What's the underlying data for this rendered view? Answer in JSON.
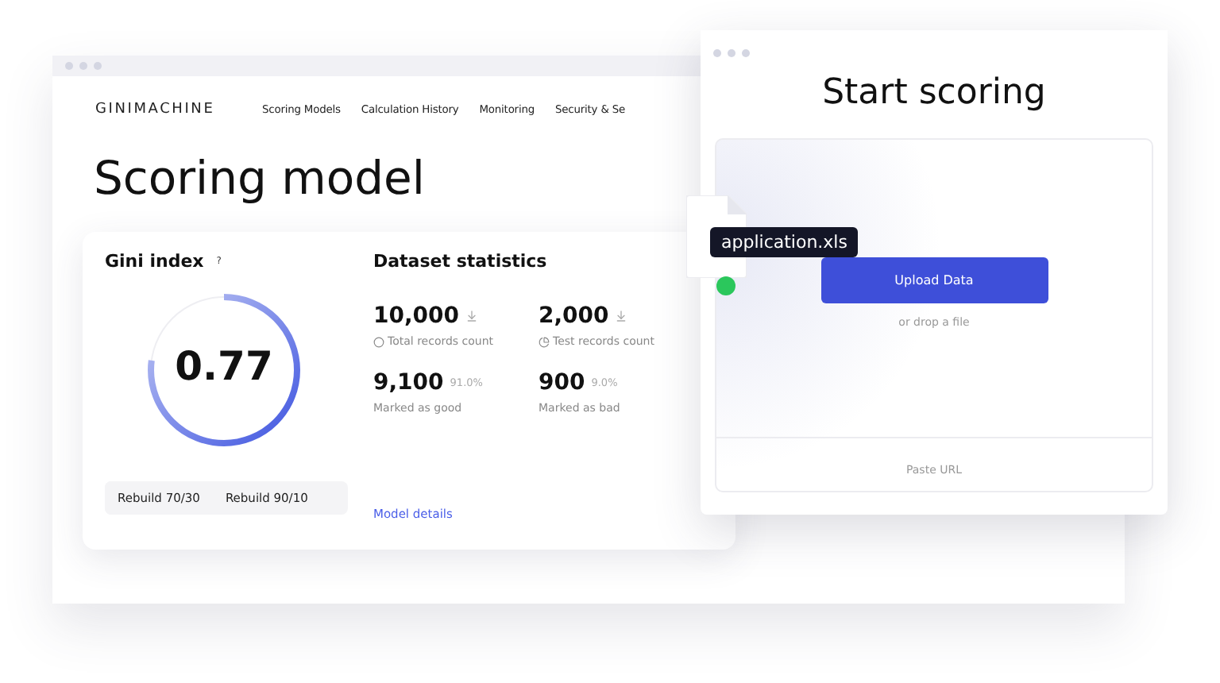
{
  "back_window": {
    "logo": "GINIMACHINE",
    "nav": [
      "Scoring Models",
      "Calculation History",
      "Monitoring",
      "Security & Se"
    ],
    "heading": "Scoring model"
  },
  "gini": {
    "title": "Gini index",
    "help": "?",
    "value": "0.77",
    "level": 0.77,
    "buttons": [
      "Rebuild 70/30",
      "Rebuild 90/10"
    ]
  },
  "dataset": {
    "title": "Dataset statistics",
    "stats": [
      {
        "kind": "total",
        "value": "10,000",
        "label": "Total records count"
      },
      {
        "kind": "test",
        "value": "2,000",
        "label": "Test records count"
      },
      {
        "kind": "share",
        "value": "9,100",
        "percent": "91.0%",
        "label": "Marked as good"
      },
      {
        "kind": "share",
        "value": "900",
        "percent": "9.0%",
        "label": "Marked as bad"
      }
    ],
    "link": "Model details"
  },
  "front_window": {
    "title": "Start scoring",
    "upload_button": "Upload Data",
    "hint": "or drop a file",
    "footer": "Paste URL",
    "file": "application.xls"
  }
}
